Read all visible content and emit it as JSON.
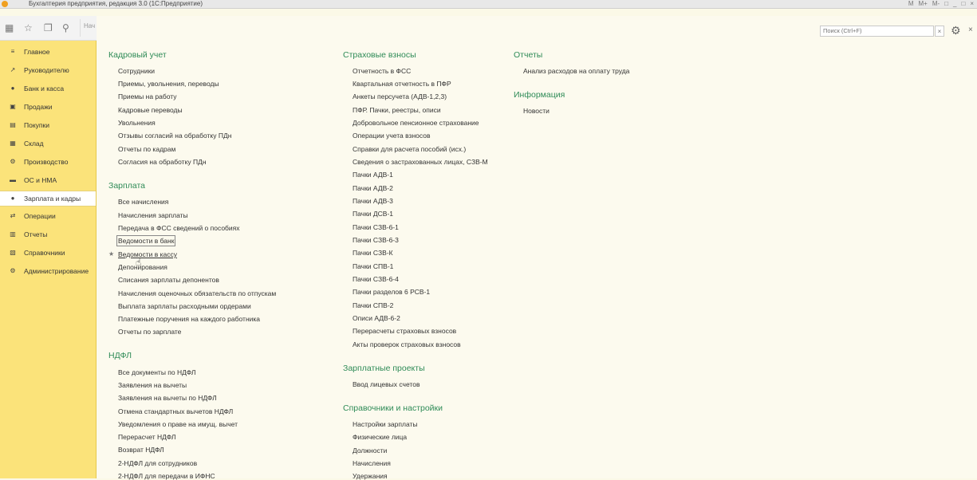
{
  "window": {
    "title": "Бухгалтерия предприятия, редакция 3.0  (1С:Предприятие)",
    "controls": [
      "M",
      "M+",
      "M-",
      "□",
      "_",
      "□",
      "×"
    ]
  },
  "toolbar": {
    "nav_label": "Нач"
  },
  "search": {
    "placeholder": "Поиск (Ctrl+F)",
    "clear": "×"
  },
  "sidebar": {
    "items": [
      {
        "label": "Главное",
        "icon": "≡"
      },
      {
        "label": "Руководителю",
        "icon": "↗"
      },
      {
        "label": "Банк и касса",
        "icon": "●"
      },
      {
        "label": "Продажи",
        "icon": "▣"
      },
      {
        "label": "Покупки",
        "icon": "▤"
      },
      {
        "label": "Склад",
        "icon": "▦"
      },
      {
        "label": "Производство",
        "icon": "⚙"
      },
      {
        "label": "ОС и НМА",
        "icon": "▬"
      },
      {
        "label": "Зарплата и кадры",
        "icon": "👤"
      },
      {
        "label": "Операции",
        "icon": "⇄"
      },
      {
        "label": "Отчеты",
        "icon": "▥"
      },
      {
        "label": "Справочники",
        "icon": "▧"
      },
      {
        "label": "Администрирование",
        "icon": "⚙"
      }
    ],
    "active_index": 8
  },
  "sections": {
    "kadry": {
      "title": "Кадровый учет",
      "links": [
        "Сотрудники",
        "Приемы, увольнения, переводы",
        "Приемы на работу",
        "Кадровые переводы",
        "Увольнения",
        "Отзывы согласий на обработку ПДн",
        "Отчеты по кадрам",
        "Согласия на обработку ПДн"
      ]
    },
    "zarplata": {
      "title": "Зарплата",
      "links": [
        "Все начисления",
        "Начисления зарплаты",
        "Передача в ФСС сведений о пособиях",
        "Ведомости в банк",
        "Ведомости в кассу",
        "Депонирования",
        "Списания зарплаты депонентов",
        "Начисления оценочных обязательств по отпускам",
        "Выплата зарплаты расходными ордерами",
        "Платежные поручения на каждого работника",
        "Отчеты по зарплате"
      ]
    },
    "ndfl": {
      "title": "НДФЛ",
      "links": [
        "Все документы по НДФЛ",
        "Заявления на вычеты",
        "Заявления на вычеты по НДФЛ",
        "Отмена стандартных вычетов НДФЛ",
        "Уведомления о праве на имущ. вычет",
        "Перерасчет НДФЛ",
        "Возврат НДФЛ",
        "2-НДФЛ для сотрудников",
        "2-НДФЛ для передачи в ИФНС"
      ]
    },
    "vznosy": {
      "title": "Страховые взносы",
      "links": [
        "Отчетность в ФСС",
        "Квартальная отчетность в ПФР",
        "Анкеты персучета (АДВ-1,2,3)",
        "ПФР. Пачки, реестры, описи",
        "Добровольное пенсионное страхование",
        "Операции учета взносов",
        "Справки для расчета пособий (исх.)",
        "Сведения о застрахованных лицах, СЗВ-М",
        "Пачки АДВ-1",
        "Пачки АДВ-2",
        "Пачки АДВ-3",
        "Пачки ДСВ-1",
        "Пачки СЗВ-6-1",
        "Пачки СЗВ-6-3",
        "Пачки СЗВ-К",
        "Пачки СПВ-1",
        "Пачки СЗВ-6-4",
        "Пачки разделов 6 РСВ-1",
        "Пачки СПВ-2",
        "Описи АДВ-6-2",
        "Перерасчеты страховых взносов",
        "Акты проверок страховых взносов"
      ]
    },
    "proekty": {
      "title": "Зарплатные проекты",
      "links": [
        "Ввод лицевых счетов"
      ]
    },
    "spravochniki": {
      "title": "Справочники и настройки",
      "links": [
        "Настройки зарплаты",
        "Физические лица",
        "Должности",
        "Начисления",
        "Удержания"
      ]
    },
    "otchety": {
      "title": "Отчеты",
      "links": [
        "Анализ расходов на оплату труда"
      ]
    },
    "info": {
      "title": "Информация",
      "links": [
        "Новости"
      ]
    }
  },
  "colors": {
    "sidebar_bg": "#fbe37a",
    "section_title": "#2e8b57",
    "panel_bg": "#fcfaee"
  }
}
